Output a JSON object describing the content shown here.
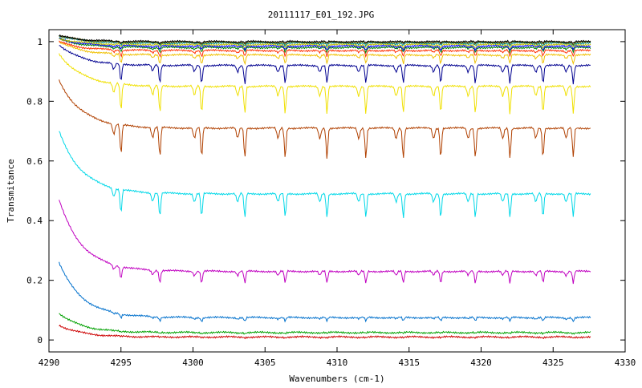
{
  "chart_data": {
    "type": "line",
    "title": "20111117_E01_192.JPG",
    "xlabel": "Wavenumbers (cm-1)",
    "ylabel": "Transmitance",
    "xlim": [
      4290,
      4330
    ],
    "ylim": [
      -0.04,
      1.04
    ],
    "x_ticks": [
      4290,
      4295,
      4300,
      4305,
      4310,
      4315,
      4320,
      4325,
      4330
    ],
    "x_tick_labels": [
      "4290",
      "4295",
      "4300",
      "4305",
      "4310",
      "4315",
      "4320",
      "4325",
      "4330"
    ],
    "y_ticks": [
      0,
      0.2,
      0.4,
      0.6,
      0.8,
      1
    ],
    "y_tick_labels": [
      "0",
      "0.2",
      "0.4",
      "0.6",
      "0.8",
      "1"
    ],
    "grid": false,
    "legend": "none",
    "x_start": 4290.7,
    "x_end": 4327.6,
    "absorption_lines": [
      4295.0,
      4297.7,
      4300.6,
      4303.6,
      4306.4,
      4309.3,
      4312.0,
      4314.6,
      4317.2,
      4319.6,
      4322.0,
      4324.3,
      4326.4
    ],
    "series": [
      {
        "color": "#cc0000",
        "start": 0.05,
        "base": 0.01,
        "depth": 0.002
      },
      {
        "color": "#00a000",
        "start": 0.09,
        "base": 0.025,
        "depth": 0.003
      },
      {
        "color": "#0070cc",
        "start": 0.26,
        "base": 0.075,
        "depth": 0.012
      },
      {
        "color": "#c000c0",
        "start": 0.47,
        "base": 0.23,
        "depth": 0.04
      },
      {
        "color": "#00d8e8",
        "start": 0.7,
        "base": 0.49,
        "depth": 0.08
      },
      {
        "color": "#b04000",
        "start": 0.87,
        "base": 0.71,
        "depth": 0.1
      },
      {
        "color": "#f0e000",
        "start": 0.96,
        "base": 0.85,
        "depth": 0.09
      },
      {
        "color": "#000090",
        "start": 0.99,
        "base": 0.92,
        "depth": 0.06
      },
      {
        "color": "#f0c000",
        "start": 1.0,
        "base": 0.955,
        "depth": 0.03
      },
      {
        "color": "#ff3000",
        "start": 1.0,
        "base": 0.97,
        "depth": 0.02
      },
      {
        "color": "#008000",
        "start": 1.01,
        "base": 0.98,
        "depth": 0.015
      },
      {
        "color": "#0000ff",
        "start": 1.01,
        "base": 0.985,
        "depth": 0.012
      },
      {
        "color": "#c0c000",
        "start": 1.01,
        "base": 0.99,
        "depth": 0.01
      },
      {
        "color": "#009090",
        "start": 1.02,
        "base": 0.995,
        "depth": 0.008
      },
      {
        "color": "#606000",
        "start": 1.02,
        "base": 0.998,
        "depth": 0.006
      },
      {
        "color": "#000000",
        "start": 1.02,
        "base": 1.0,
        "depth": 0.005
      }
    ]
  }
}
